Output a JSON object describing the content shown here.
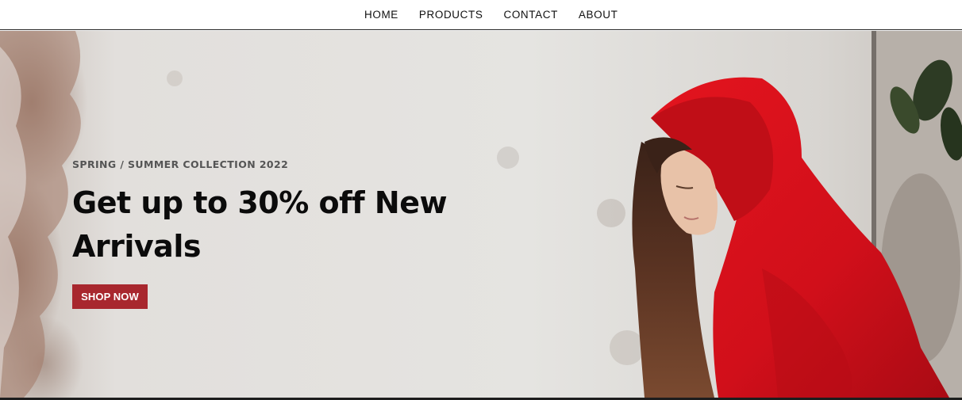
{
  "nav": {
    "items": [
      {
        "label": "HOME"
      },
      {
        "label": "PRODUCTS"
      },
      {
        "label": "CONTACT"
      },
      {
        "label": "ABOUT"
      }
    ]
  },
  "hero": {
    "subtitle": "SPRING / SUMMER COLLECTION 2022",
    "title": "Get up to 30% off New Arrivals",
    "cta_label": "SHOP NOW"
  },
  "colors": {
    "accent": "#a8272e",
    "hoodie": "#d6141c",
    "text_dark": "#0b0b0b"
  }
}
